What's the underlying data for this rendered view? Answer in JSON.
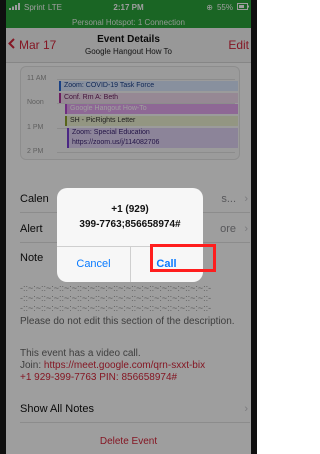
{
  "status_bar": {
    "carrier": "Sprint",
    "network": "LTE",
    "time": "2:17 PM",
    "battery": "55%",
    "hotspot_text": "Personal Hotspot: 1 Connection",
    "background_color": "#2aa43a"
  },
  "nav": {
    "back_label": "Mar 17",
    "title": "Event Details",
    "subtitle": "Google Hangout How To",
    "edit_label": "Edit",
    "accent_color": "#d6263a"
  },
  "calendar_preview": {
    "hours": [
      "11 AM",
      "Noon",
      "1 PM",
      "2 PM"
    ],
    "events": [
      "Zoom: COVID-19 Task Force",
      "Conf. Rm A: Beth",
      "Google Hangout How-To",
      "SH - PicRights Letter",
      "Zoom: Special Education",
      "https://zoom.us/j/114082706"
    ]
  },
  "rows": {
    "calendar_label": "Calen",
    "calendar_value": "s...",
    "alert_label": "Alert",
    "alert_value": "ore",
    "notes_label": "Note"
  },
  "notes": {
    "dashes_1": "-::~:~::~:~::~:~::~:~::~:~::~:~::~:~::~:~::~:~::~:~::-",
    "dashes_2": "-::~:~::~:~::~:~::~:~::~:~::~:~::~:~::~:~::~:~::~:~::-",
    "dashes_3": "-::~:~::~:~::~:~::~:~::~:~::~:~::~:~::~:~::~:~::~:~::-",
    "warning": "Please do not edit this section of the description.",
    "video_call_text": "This event has a video call.",
    "join_prefix": "Join: ",
    "join_link": "https://meet.google.com/qrn-sxxt-bix",
    "phone_line": "+1 929-399-7763 PIN: 856658974#"
  },
  "show_all_notes": "Show All Notes",
  "delete_event": "Delete Event",
  "alert_dialog": {
    "line1": "+1 (929)",
    "line2": "399-7763;856658974#",
    "cancel_label": "Cancel",
    "call_label": "Call",
    "button_color": "#0a7bff",
    "highlight_color": "#ff1e1e"
  }
}
